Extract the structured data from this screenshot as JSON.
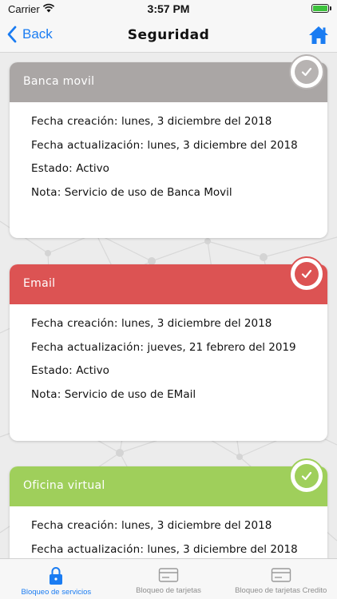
{
  "status_bar": {
    "carrier": "Carrier",
    "time": "3:57 PM"
  },
  "nav": {
    "back_label": "Back",
    "title": "Seguridad"
  },
  "cards": [
    {
      "title": "Banca movil",
      "header_color": "#aaa6a5",
      "check_color": "#b7b3b2",
      "rows": [
        {
          "label": "Fecha creación:",
          "value": "lunes, 3 diciembre del 2018"
        },
        {
          "label": "Fecha actualización:",
          "value": "lunes, 3 diciembre del 2018"
        },
        {
          "label": "Estado:",
          "value": "Activo"
        },
        {
          "label": "Nota:",
          "value": "Servicio de uso de Banca Movil"
        }
      ]
    },
    {
      "title": "Email",
      "header_color": "#dc5353",
      "check_color": "#dc5353",
      "rows": [
        {
          "label": "Fecha creación:",
          "value": "lunes, 3 diciembre del 2018"
        },
        {
          "label": "Fecha actualización:",
          "value": "jueves, 21 febrero del 2019"
        },
        {
          "label": "Estado:",
          "value": "Activo"
        },
        {
          "label": "Nota:",
          "value": "Servicio de uso de EMail"
        }
      ]
    },
    {
      "title": "Oficina virtual",
      "header_color": "#9fcf5b",
      "check_color": "#9fcf5b",
      "rows": [
        {
          "label": "Fecha creación:",
          "value": "lunes, 3 diciembre del 2018"
        },
        {
          "label": "Fecha actualización:",
          "value": "lunes, 3 diciembre del 2018"
        }
      ]
    }
  ],
  "tabs": [
    {
      "label": "Bloqueo de servicios",
      "icon": "lock-icon",
      "active": true
    },
    {
      "label": "Bloqueo de tarjetas",
      "icon": "card-icon",
      "active": false
    },
    {
      "label": "Bloqueo de tarjetas Credito",
      "icon": "credit-card-icon",
      "active": false
    }
  ],
  "colors": {
    "accent": "#1a7cf2"
  }
}
